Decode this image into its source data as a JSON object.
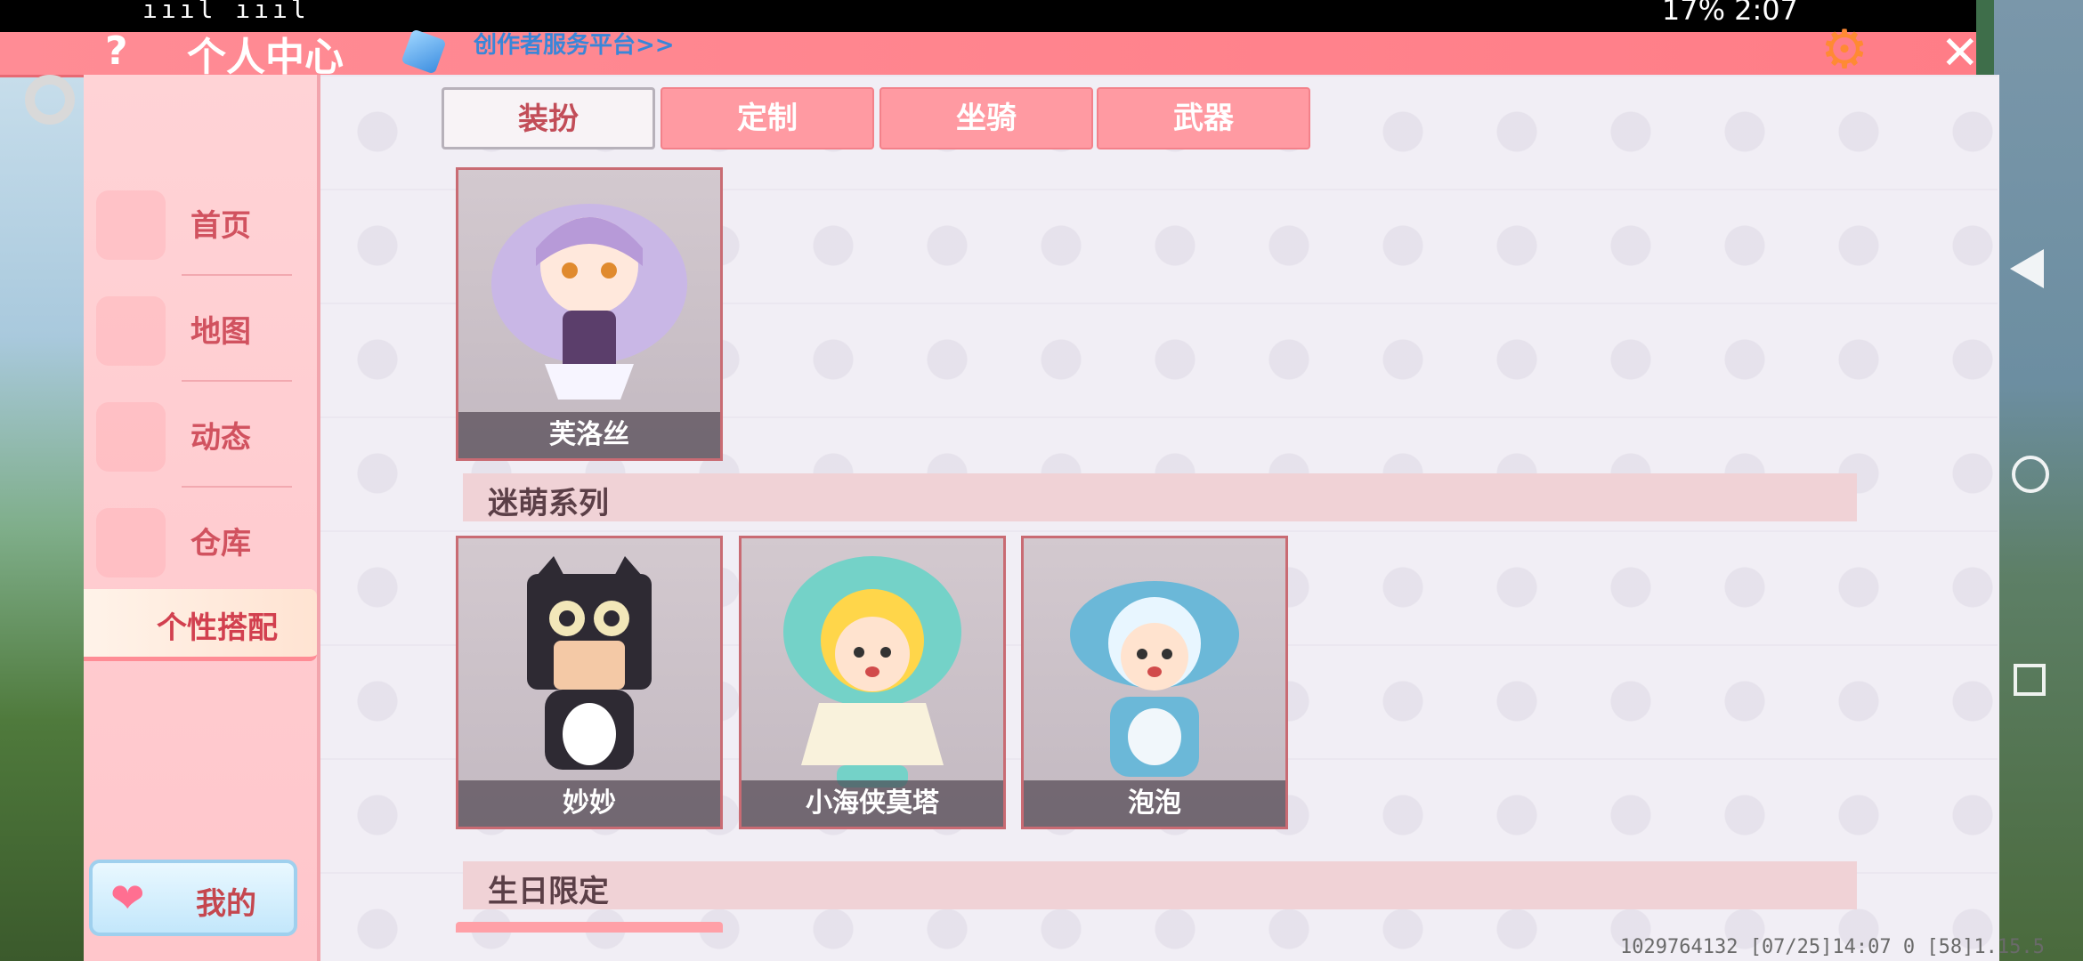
{
  "status": {
    "left": "ıııl ıııl",
    "right": "17% 2:07"
  },
  "header": {
    "help": "?",
    "title": "个人中心",
    "link": "创作者服务平台>>",
    "close": "✕"
  },
  "sidebar": {
    "items": [
      {
        "label": "首页"
      },
      {
        "label": "地图"
      },
      {
        "label": "动态"
      },
      {
        "label": "仓库"
      },
      {
        "label": "个性搭配"
      }
    ],
    "my_button": "我的"
  },
  "tabs": [
    {
      "label": "装扮",
      "active": true
    },
    {
      "label": "定制",
      "active": false
    },
    {
      "label": "坐骑",
      "active": false
    },
    {
      "label": "武器",
      "active": false
    }
  ],
  "cards_top": [
    {
      "name": "芙洛丝"
    }
  ],
  "sections": [
    {
      "label": "迷萌系列"
    },
    {
      "label": "生日限定"
    }
  ],
  "cards_series": [
    {
      "name": "妙妙"
    },
    {
      "name": "小海侠莫塔"
    },
    {
      "name": "泡泡"
    }
  ],
  "footer": {
    "info": "1029764132    [07/25]14:07 0   [58]1.15.5"
  }
}
